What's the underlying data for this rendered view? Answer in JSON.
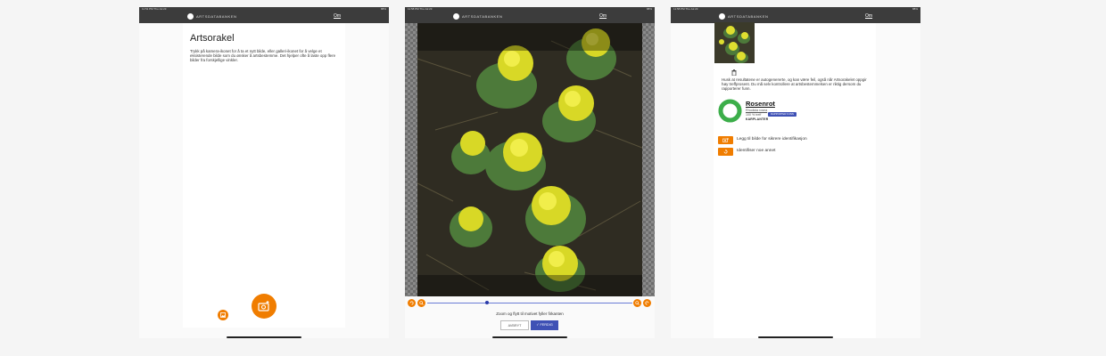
{
  "status_bar": {
    "screen1_time": "11:51 PM  Thu Jul 23",
    "screen2_time": "11:58 PM  Thu Jul 23",
    "screen3_time": "11:58 PM  Thu Jul 23",
    "screen1_right": "88%",
    "screen2_right": "88%",
    "screen3_right": "88%"
  },
  "app_bar": {
    "brand": "ARTSDATABANKEN",
    "om_link": "Om"
  },
  "screen1": {
    "title": "Artsorakel",
    "instructions": "Trykk på kamera-ikonet for å ta et nytt bilde, eller galleri-ikonet for å velge et eksisterende bilde som du ønsker å artsbestemme. Det hjelper ofte å laste opp flere bilder fra forskjellige vinkler.",
    "camera_button_icon": "add-photo-icon",
    "gallery_button_icon": "gallery-icon"
  },
  "screen2": {
    "hint": "Zoom og flytt til motivet fyller firkanten",
    "cancel_label": "AVBRYT",
    "done_label": "FERDIG",
    "zoom_level": 0.29
  },
  "screen3": {
    "note": "Husk at resultatene er autogenererte, og kan være feil, også når Artsorakelet oppgir høy treffprosent. Du må selv kontrollere at artsbestemmelsen er riktig dersom du rapporterer funn.",
    "result": {
      "name": "Rosenrot",
      "latin": "Rhodiola rosea",
      "confidence_text": "100 % treff",
      "badge": "RAPPORTER FUNN",
      "category": "KARPLANTER",
      "confidence": 1.0
    },
    "actions": [
      {
        "label": "Legg til bilde for sikrere identifikasjon",
        "icon": "add-photo-icon"
      },
      {
        "label": "Identifiser noe annet",
        "icon": "refresh-icon"
      }
    ]
  },
  "colors": {
    "accent": "#f07d00",
    "primary": "#3f51b5",
    "appbar": "#3c3c3c",
    "ring": "#3cae4a"
  }
}
